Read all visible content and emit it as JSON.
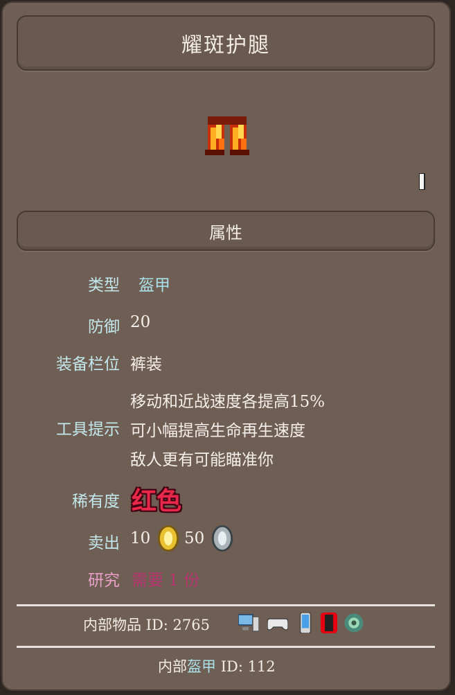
{
  "title": "耀斑护腿",
  "section_title": "属性",
  "properties": {
    "type_label": "类型",
    "type_value": "盔甲",
    "defense_label": "防御",
    "defense_value": "20",
    "slot_label": "装备栏位",
    "slot_value": "裤装",
    "tooltip_label": "工具提示",
    "tooltip_lines": [
      "移动和近战速度各提高15%",
      "可小幅提高生命再生速度",
      "敌人更有可能瞄准你"
    ],
    "rarity_label": "稀有度",
    "rarity_value": "红色",
    "sell_label": "卖出",
    "sell_gold": "10",
    "sell_silver": "50",
    "research_label": "研究",
    "research_value": "需要 1 份"
  },
  "footer": {
    "item_id_label": "内部物品 ID: 2765",
    "armor_id_prefix": "内部",
    "armor_id_word": "盔甲",
    "armor_id_suffix": "ID: 112"
  },
  "colors": {
    "panel": "#6f5e53",
    "label_cyan": "#c3e8ec",
    "rarity_red": "#e8284a",
    "research_pink": "#d0287a"
  },
  "icons": [
    "flare-leggings-icon",
    "gold-coin-icon",
    "silver-coin-icon",
    "desktop-icon",
    "console-icon",
    "mobile-icon",
    "switch-icon",
    "tmodloader-icon"
  ]
}
